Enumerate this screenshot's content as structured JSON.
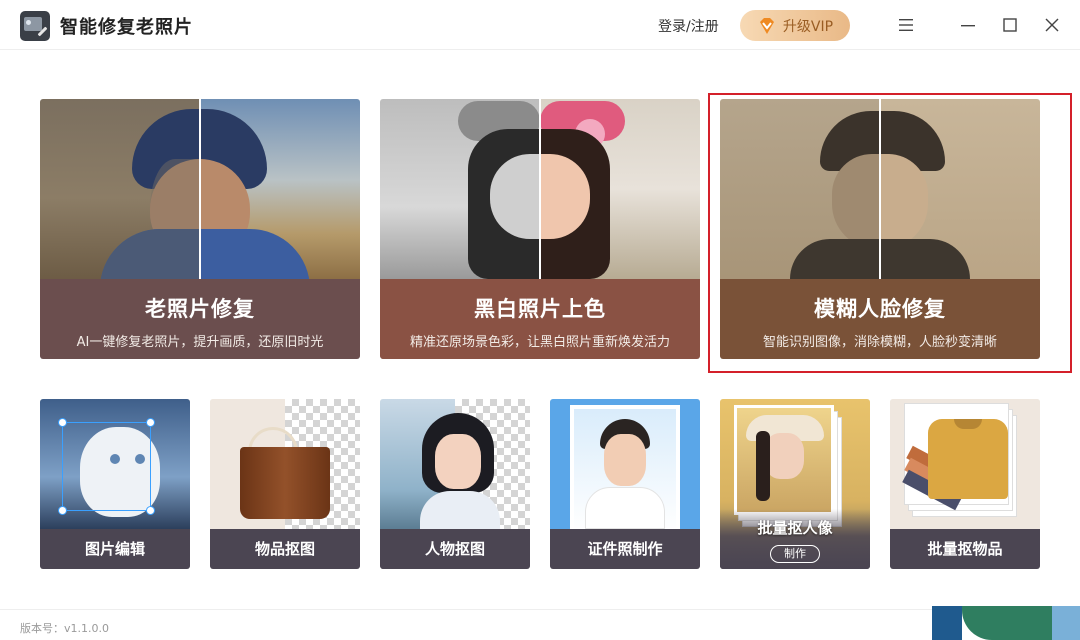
{
  "window": {
    "title": "智能修复老照片",
    "login_label": "登录/注册",
    "vip_label": "升级VIP"
  },
  "features_large": [
    {
      "title": "老照片修复",
      "subtitle": "AI一键修复老照片，提升画质，还原旧时光",
      "caption_color": "#6b4e4e"
    },
    {
      "title": "黑白照片上色",
      "subtitle": "精准还原场景色彩，让黑白照片重新焕发活力",
      "caption_color": "#8a5244"
    },
    {
      "title": "模糊人脸修复",
      "subtitle": "智能识别图像，消除模糊，人脸秒变清晰",
      "caption_color": "#7a5238",
      "selected": true
    }
  ],
  "features_small": [
    {
      "label": "图片编辑"
    },
    {
      "label": "物品抠图"
    },
    {
      "label": "人物抠图"
    },
    {
      "label": "证件照制作"
    },
    {
      "label": "批量抠人像",
      "button": "制作"
    },
    {
      "label": "批量抠物品"
    }
  ],
  "footer": {
    "version_label": "版本号：v1.1.0.0"
  },
  "colors": {
    "accent_red": "#d4202a",
    "vip_text": "#9a5d23",
    "small_card_bar": "#4b4552"
  }
}
